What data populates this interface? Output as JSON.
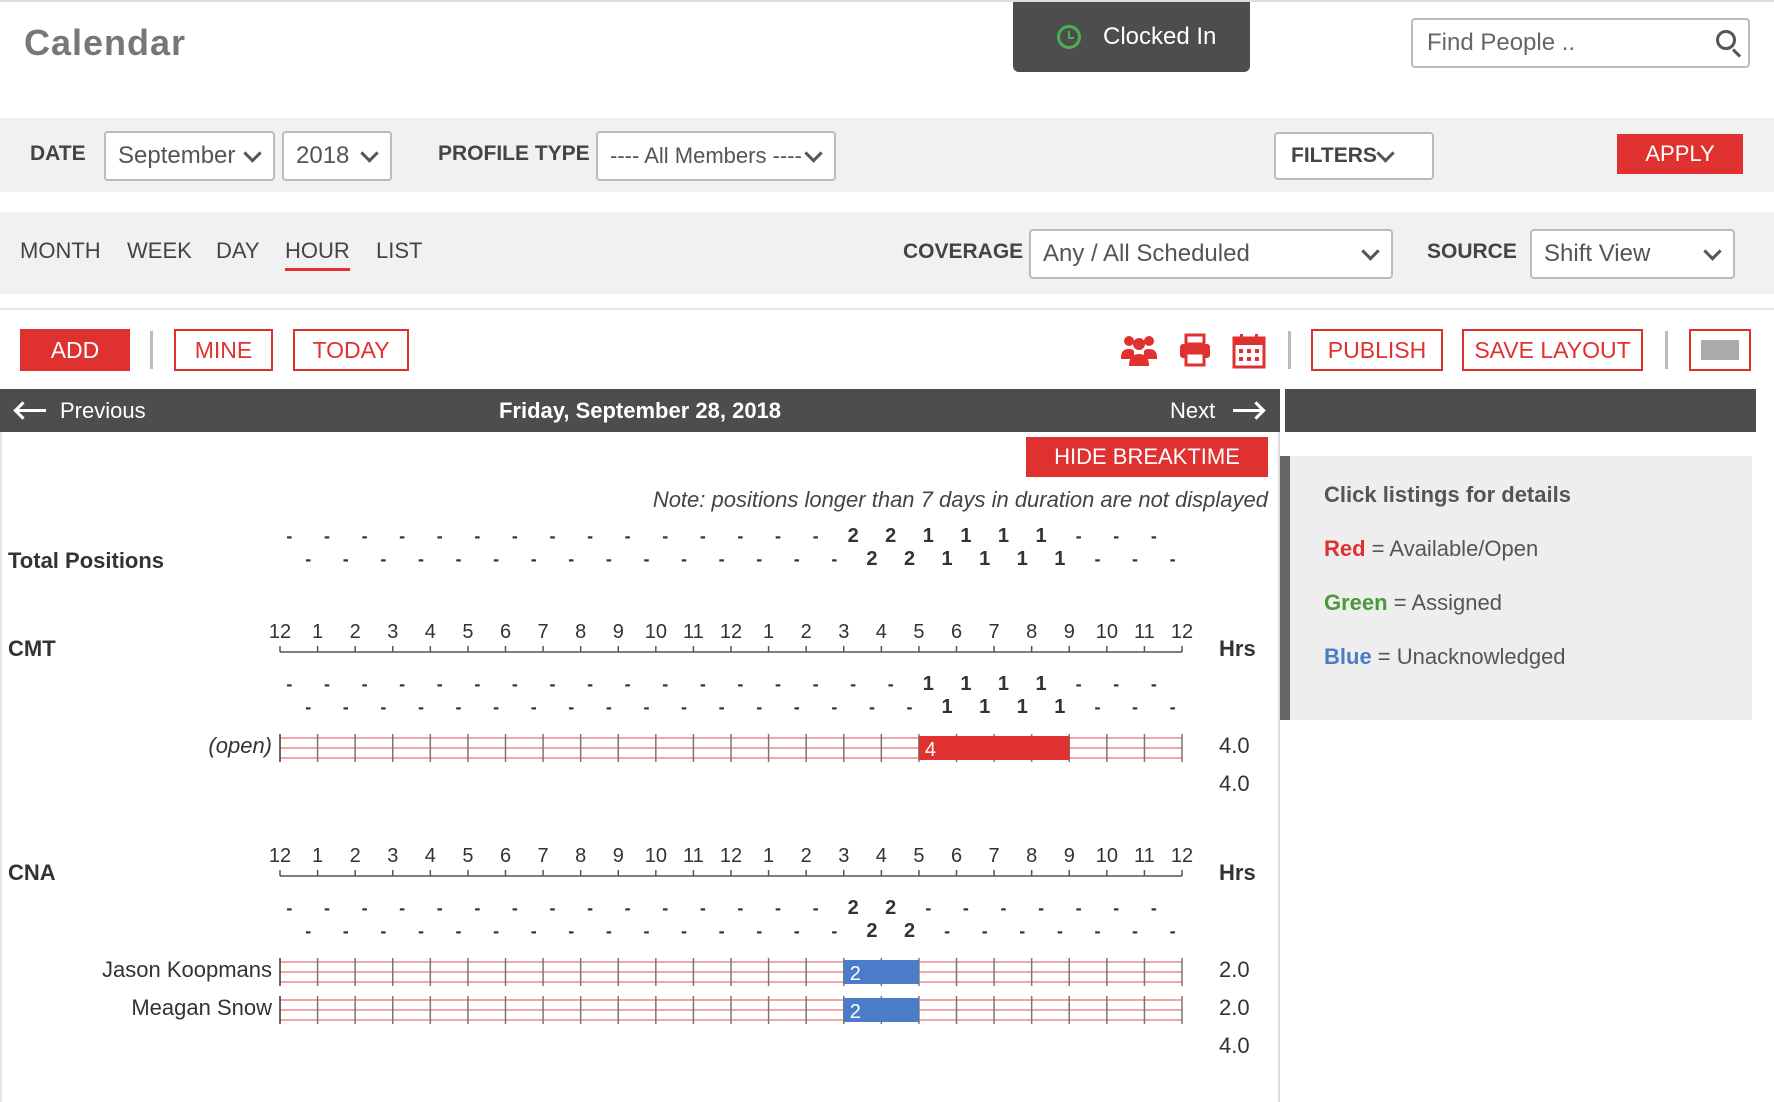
{
  "header": {
    "title": "Calendar",
    "clock_status": "Clocked In",
    "search_placeholder": "Find People .."
  },
  "filters": {
    "date_label": "DATE",
    "month": "September",
    "year": "2018",
    "profile_type_label": "PROFILE TYPE",
    "profile_type": "---- All Members ----",
    "filters_label": "FILTERS",
    "apply_label": "APPLY"
  },
  "views": {
    "tabs": [
      "MONTH",
      "WEEK",
      "DAY",
      "HOUR",
      "LIST"
    ],
    "active": "HOUR",
    "coverage_label": "COVERAGE",
    "coverage": "Any / All Scheduled",
    "source_label": "SOURCE",
    "source": "Shift View"
  },
  "toolbar": {
    "add": "ADD",
    "mine": "MINE",
    "today": "TODAY",
    "publish": "PUBLISH",
    "save_layout": "SAVE LAYOUT"
  },
  "nav": {
    "previous": "Previous",
    "date": "Friday, September 28, 2018",
    "next": "Next"
  },
  "schedule": {
    "hide_breaktime": "HIDE BREAKTIME",
    "note": "Note: positions longer than 7 days in duration are not displayed",
    "total_label": "Total Positions",
    "hrs_label": "Hrs",
    "hour_labels": [
      "12",
      "1",
      "2",
      "3",
      "4",
      "5",
      "6",
      "7",
      "8",
      "9",
      "10",
      "11",
      "12",
      "1",
      "2",
      "3",
      "4",
      "5",
      "6",
      "7",
      "8",
      "9",
      "10",
      "11",
      "12"
    ],
    "total_counts": [
      "-",
      "-",
      "-",
      "-",
      "-",
      "-",
      "-",
      "-",
      "-",
      "-",
      "-",
      "-",
      "-",
      "-",
      "-",
      "-",
      "-",
      "-",
      "-",
      "-",
      "-",
      "-",
      "-",
      "-",
      "-",
      "-",
      "-",
      "-",
      "-",
      "-",
      "2",
      "2",
      "2",
      "2",
      "1",
      "1",
      "1",
      "1",
      "1",
      "1",
      "1",
      "1",
      "-",
      "-",
      "-",
      "-",
      "-",
      "-"
    ],
    "groups": [
      {
        "name": "CMT",
        "counts": [
          "-",
          "-",
          "-",
          "-",
          "-",
          "-",
          "-",
          "-",
          "-",
          "-",
          "-",
          "-",
          "-",
          "-",
          "-",
          "-",
          "-",
          "-",
          "-",
          "-",
          "-",
          "-",
          "-",
          "-",
          "-",
          "-",
          "-",
          "-",
          "-",
          "-",
          "-",
          "-",
          "-",
          "-",
          "1",
          "1",
          "1",
          "1",
          "1",
          "1",
          "1",
          "1",
          "-",
          "-",
          "-",
          "-",
          "-",
          "-"
        ],
        "rows": [
          {
            "label": "(open)",
            "open": true,
            "hours": "4.0",
            "start": 17,
            "end": 21,
            "value": "4",
            "color": "#e03131"
          }
        ],
        "total_hours": "4.0"
      },
      {
        "name": "CNA",
        "counts": [
          "-",
          "-",
          "-",
          "-",
          "-",
          "-",
          "-",
          "-",
          "-",
          "-",
          "-",
          "-",
          "-",
          "-",
          "-",
          "-",
          "-",
          "-",
          "-",
          "-",
          "-",
          "-",
          "-",
          "-",
          "-",
          "-",
          "-",
          "-",
          "-",
          "-",
          "2",
          "2",
          "2",
          "2",
          "-",
          "-",
          "-",
          "-",
          "-",
          "-",
          "-",
          "-",
          "-",
          "-",
          "-",
          "-",
          "-",
          "-"
        ],
        "rows": [
          {
            "label": "Jason Koopmans",
            "open": false,
            "hours": "2.0",
            "start": 15,
            "end": 17,
            "value": "2",
            "color": "#4a7cc9"
          },
          {
            "label": "Meagan Snow",
            "open": false,
            "hours": "2.0",
            "start": 15,
            "end": 17,
            "value": "2",
            "color": "#4a7cc9"
          }
        ],
        "total_hours": "4.0"
      }
    ]
  },
  "legend": {
    "title": "Click listings for details",
    "items": [
      {
        "key": "Red",
        "text": " = Available/Open",
        "color": "#e03131"
      },
      {
        "key": "Green",
        "text": " = Assigned",
        "color": "#4a9a3c"
      },
      {
        "key": "Blue",
        "text": " = Unacknowledged",
        "color": "#4a7cc9"
      }
    ]
  }
}
